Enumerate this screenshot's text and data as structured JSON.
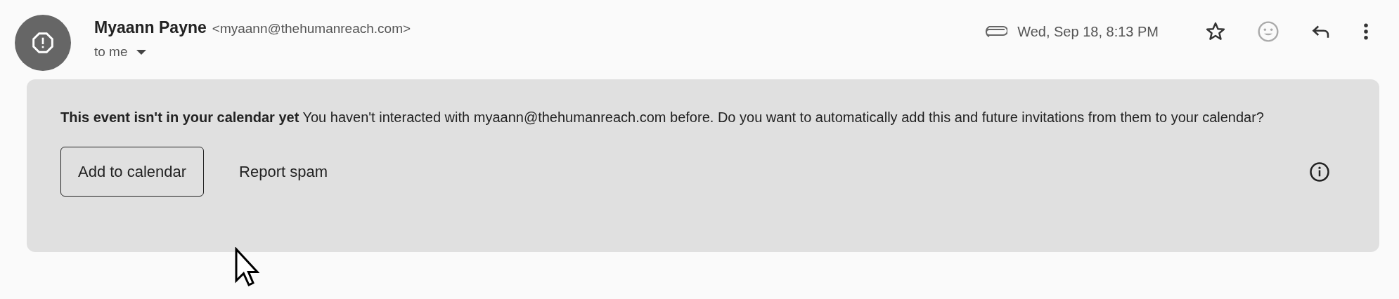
{
  "sender": {
    "name": "Myaann Payne",
    "email": "<myaann@thehumanreach.com>",
    "recipient": "to me"
  },
  "header": {
    "date": "Wed, Sep 18, 8:13 PM",
    "has_attachment": true,
    "starred": false
  },
  "banner": {
    "message": "**This event isn't in your calendar yet** You haven't interacted with myaann@thehumanreach.com before. Do you want to automatically add this and future invitations from them to your calendar?",
    "buttons": [
      {
        "label": "Add to calendar",
        "kind": "outlined"
      },
      {
        "label": "Report spam",
        "kind": "text"
      }
    ]
  }
}
